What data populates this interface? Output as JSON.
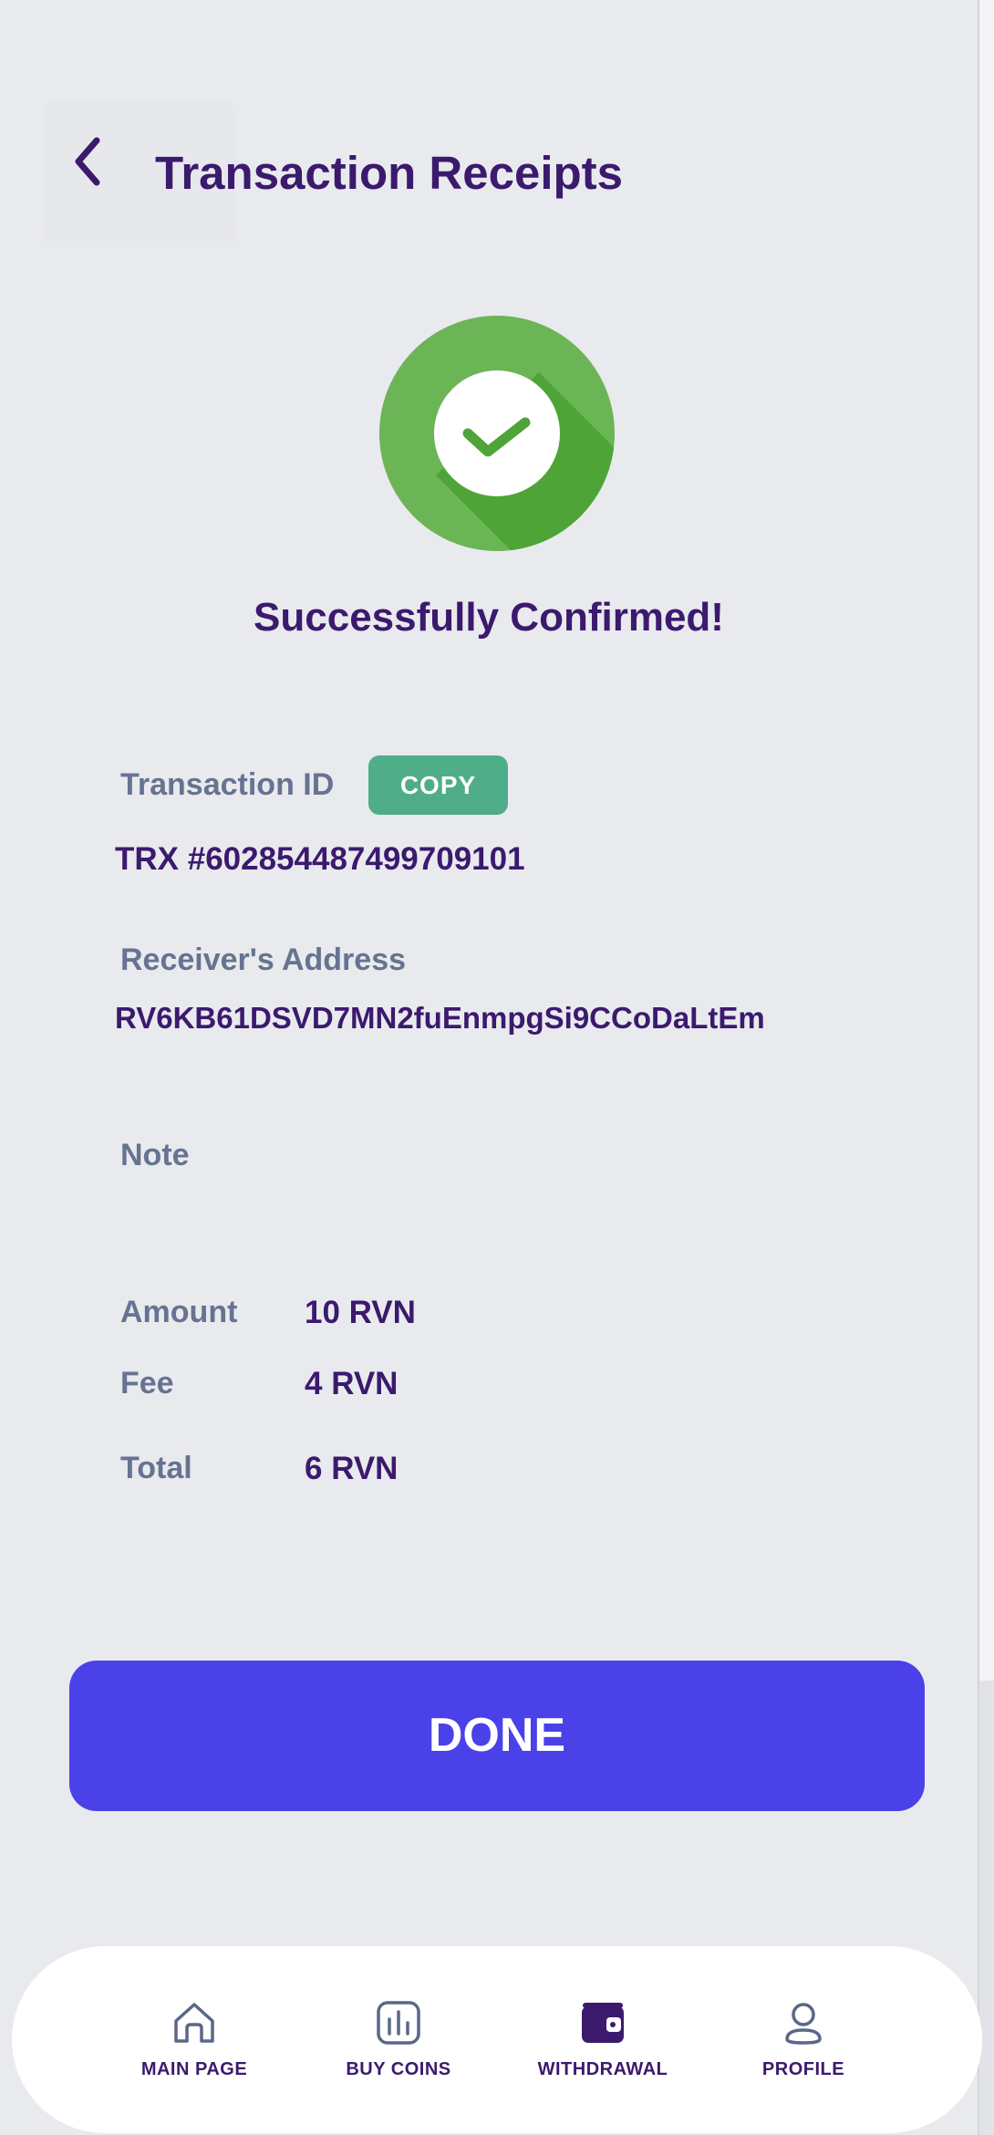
{
  "header": {
    "title": "Transaction Receipts"
  },
  "status": {
    "message": "Successfully Confirmed!"
  },
  "transaction": {
    "id_label": "Transaction ID",
    "copy_label": "COPY",
    "id_value": "TRX #602854487499709101",
    "receiver_label": "Receiver's Address",
    "receiver_value": "RV6KB61DSVD7MN2fuEnmpgSi9CCoDaLtEm",
    "note_label": "Note",
    "amount_label": "Amount",
    "amount_value": "10 RVN",
    "fee_label": "Fee",
    "fee_value": "4 RVN",
    "total_label": "Total",
    "total_value": "6 RVN"
  },
  "actions": {
    "done_label": "DONE"
  },
  "nav": {
    "items": [
      {
        "label": "MAIN PAGE",
        "icon": "home-icon"
      },
      {
        "label": "BUY COINS",
        "icon": "chart-icon"
      },
      {
        "label": "WITHDRAWAL",
        "icon": "wallet-icon"
      },
      {
        "label": "PROFILE",
        "icon": "user-icon"
      }
    ]
  },
  "colors": {
    "primary_text": "#3b1a6e",
    "secondary_text": "#667391",
    "success_green": "#6cb556",
    "copy_green": "#4fad8a",
    "done_button": "#4a41e8",
    "background": "#e9eaee"
  }
}
